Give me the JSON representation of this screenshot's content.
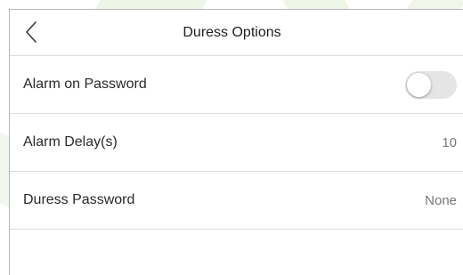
{
  "header": {
    "title": "Duress Options",
    "back_icon": "chevron-left-icon"
  },
  "settings": [
    {
      "label": "Alarm on Password",
      "type": "toggle",
      "enabled": false
    },
    {
      "label": "Alarm Delay(s)",
      "type": "value",
      "value": "10"
    },
    {
      "label": "Duress Password",
      "type": "value",
      "value": "None"
    }
  ],
  "colors": {
    "toggle_off_track": "#e5e5e5",
    "divider": "#dddddd",
    "value_text": "#777777"
  }
}
